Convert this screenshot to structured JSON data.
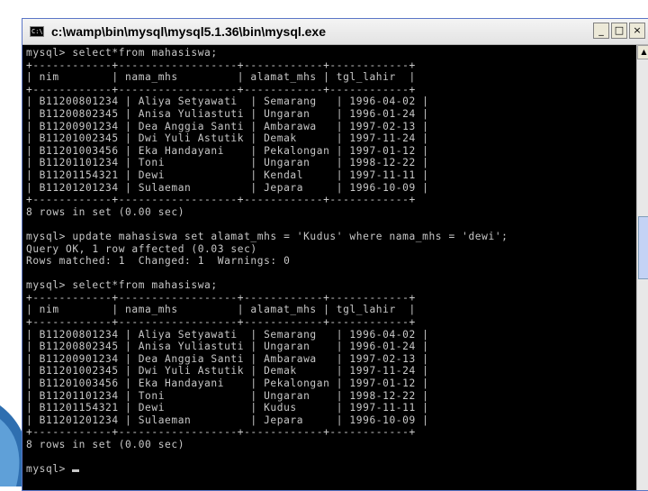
{
  "window": {
    "title": "c:\\wamp\\bin\\mysql\\mysql5.1.36\\bin\\mysql.exe",
    "icon": "cmd-icon",
    "icon_label": "C:\\",
    "minimize": "_",
    "maximize": "□",
    "close": "×"
  },
  "console": {
    "lines": [
      "mysql> select*from mahasiswa;",
      "+------------+------------------+------------+------------+",
      "| nim        | nama_mhs         | alamat_mhs | tgl_lahir  |",
      "+------------+------------------+------------+------------+",
      "| B11200801234 | Aliya Setyawati  | Semarang   | 1996-04-02 |",
      "| B11200802345 | Anisa Yuliastuti | Ungaran    | 1996-01-24 |",
      "| B11200901234 | Dea Anggia Santi | Ambarawa   | 1997-02-13 |",
      "| B11201002345 | Dwi Yuli Astutik | Demak      | 1997-11-24 |",
      "| B11201003456 | Eka Handayani    | Pekalongan | 1997-01-12 |",
      "| B11201101234 | Toni             | Ungaran    | 1998-12-22 |",
      "| B11201154321 | Dewi             | Kendal     | 1997-11-11 |",
      "| B11201201234 | Sulaeman         | Jepara     | 1996-10-09 |",
      "+------------+------------------+------------+------------+",
      "8 rows in set (0.00 sec)",
      "",
      "mysql> update mahasiswa set alamat_mhs = 'Kudus' where nama_mhs = 'dewi';",
      "Query OK, 1 row affected (0.03 sec)",
      "Rows matched: 1  Changed: 1  Warnings: 0",
      "",
      "mysql> select*from mahasiswa;",
      "+------------+------------------+------------+------------+",
      "| nim        | nama_mhs         | alamat_mhs | tgl_lahir  |",
      "+------------+------------------+------------+------------+",
      "| B11200801234 | Aliya Setyawati  | Semarang   | 1996-04-02 |",
      "| B11200802345 | Anisa Yuliastuti | Ungaran    | 1996-01-24 |",
      "| B11200901234 | Dea Anggia Santi | Ambarawa   | 1997-02-13 |",
      "| B11201002345 | Dwi Yuli Astutik | Demak      | 1997-11-24 |",
      "| B11201003456 | Eka Handayani    | Pekalongan | 1997-01-12 |",
      "| B11201101234 | Toni             | Ungaran    | 1998-12-22 |",
      "| B11201154321 | Dewi             | Kudus      | 1997-11-11 |",
      "| B11201201234 | Sulaeman         | Jepara     | 1996-10-09 |",
      "+------------+------------------+------------+------------+",
      "8 rows in set (0.00 sec)",
      "",
      "mysql> "
    ],
    "text_color": "#c8c8c8",
    "background": "#000000"
  }
}
